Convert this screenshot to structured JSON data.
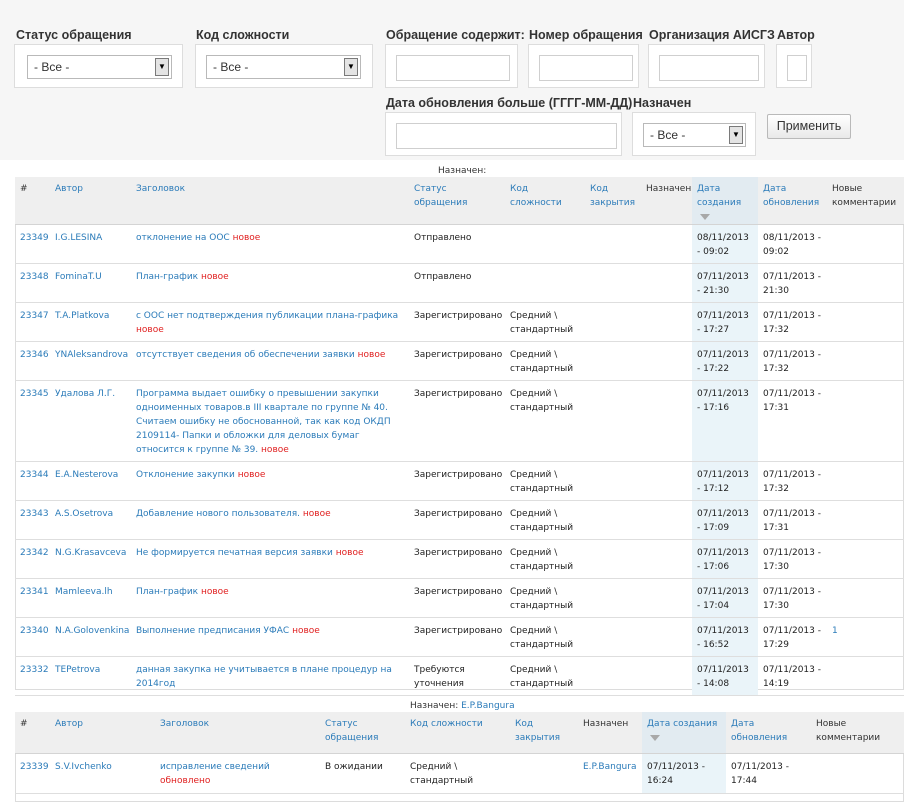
{
  "filters": {
    "status": {
      "label": "Статус обращения",
      "value": "- Все -"
    },
    "complexity": {
      "label": "Код сложности",
      "value": "- Все -"
    },
    "contains": {
      "label": "Обращение содержит:",
      "value": ""
    },
    "number": {
      "label": "Номер обращения",
      "value": ""
    },
    "org": {
      "label": "Организация АИСГЗ",
      "value": ""
    },
    "author": {
      "label": "Автор",
      "value": ""
    },
    "updated": {
      "label": "Дата обновления больше (ГГГГ-ММ-ДД)",
      "value": ""
    },
    "assigned": {
      "label": "Назначен",
      "value": "- Все -"
    },
    "apply_label": "Применить"
  },
  "new_badge": "новое",
  "updated_badge": "обновлено",
  "group1": {
    "caption": "Назначен:",
    "assignee": "",
    "headers": [
      "#",
      "Автор",
      "Заголовок",
      "Статус обращения",
      "Код сложности",
      "Код закрытия",
      "Назначен",
      "Дата создания",
      "Дата обновления",
      "Новые комментарии"
    ],
    "rows": [
      {
        "id": "23349",
        "author": "I.G.LESINA",
        "title": "отклонение на ООС",
        "badge": "новое",
        "status": "Отправлено",
        "complexity": "",
        "close": "",
        "assigned": "",
        "created": "08/11/2013 - 09:02",
        "updated": "08/11/2013 - 09:02",
        "comments": ""
      },
      {
        "id": "23348",
        "author": "FominaT.U",
        "title": "План-график",
        "badge": "новое",
        "status": "Отправлено",
        "complexity": "",
        "close": "",
        "assigned": "",
        "created": "07/11/2013 - 21:30",
        "updated": "07/11/2013 - 21:30",
        "comments": ""
      },
      {
        "id": "23347",
        "author": "T.A.Platkova",
        "title": "с ООС нет подтверждения публикации плана-графика",
        "badge": "новое",
        "status": "Зарегистрировано",
        "complexity": "Средний \\ стандартный",
        "close": "",
        "assigned": "",
        "created": "07/11/2013 - 17:27",
        "updated": "07/11/2013 - 17:32",
        "comments": ""
      },
      {
        "id": "23346",
        "author": "YNAleksandrova",
        "title": "отсутствует сведения об обеспечении заявки",
        "badge": "новое",
        "status": "Зарегистрировано",
        "complexity": "Средний \\ стандартный",
        "close": "",
        "assigned": "",
        "created": "07/11/2013 - 17:22",
        "updated": "07/11/2013 - 17:32",
        "comments": ""
      },
      {
        "id": "23345",
        "author": "Удалова Л.Г.",
        "title": "Программа выдает ошибку о превышении закупки одноименных товаров.в III квартале по группе № 40. Считаем ошибку не обоснованной, так как код ОКДП 2109114- Папки и обложки для деловых бумаг относится к группе № 39.",
        "badge": "новое",
        "status": "Зарегистрировано",
        "complexity": "Средний \\ стандартный",
        "close": "",
        "assigned": "",
        "created": "07/11/2013 - 17:16",
        "updated": "07/11/2013 - 17:31",
        "comments": ""
      },
      {
        "id": "23344",
        "author": "E.A.Nesterova",
        "title": "Отклонение закупки",
        "badge": "новое",
        "status": "Зарегистрировано",
        "complexity": "Средний \\ стандартный",
        "close": "",
        "assigned": "",
        "created": "07/11/2013 - 17:12",
        "updated": "07/11/2013 - 17:32",
        "comments": ""
      },
      {
        "id": "23343",
        "author": "A.S.Osetrova",
        "title": "Добавление нового пользователя.",
        "badge": "новое",
        "status": "Зарегистрировано",
        "complexity": "Средний \\ стандартный",
        "close": "",
        "assigned": "",
        "created": "07/11/2013 - 17:09",
        "updated": "07/11/2013 - 17:31",
        "comments": ""
      },
      {
        "id": "23342",
        "author": "N.G.Krasavceva",
        "title": "Не формируется печатная версия заявки",
        "badge": "новое",
        "status": "Зарегистрировано",
        "complexity": "Средний \\ стандартный",
        "close": "",
        "assigned": "",
        "created": "07/11/2013 - 17:06",
        "updated": "07/11/2013 - 17:30",
        "comments": ""
      },
      {
        "id": "23341",
        "author": "Mamleeva.lh",
        "title": "План-график",
        "badge": "новое",
        "status": "Зарегистрировано",
        "complexity": "Средний \\ стандартный",
        "close": "",
        "assigned": "",
        "created": "07/11/2013 - 17:04",
        "updated": "07/11/2013 - 17:30",
        "comments": ""
      },
      {
        "id": "23340",
        "author": "N.A.Golovenkina",
        "title": "Выполнение предписания УФАС",
        "badge": "новое",
        "status": "Зарегистрировано",
        "complexity": "Средний \\ стандартный",
        "close": "",
        "assigned": "",
        "created": "07/11/2013 - 16:52",
        "updated": "07/11/2013 - 17:29",
        "comments": "1"
      },
      {
        "id": "23332",
        "author": "TEPetrova",
        "title": "данная закупка не учитывается в плане процедур на 2014год",
        "badge": "",
        "status": "Требуются уточнения",
        "complexity": "Средний \\ стандартный",
        "close": "",
        "assigned": "",
        "created": "07/11/2013 - 14:08",
        "updated": "07/11/2013 - 14:19",
        "comments": ""
      }
    ]
  },
  "group2": {
    "caption": "Назначен:",
    "assignee": "E.P.Bangura",
    "headers": [
      "#",
      "Автор",
      "Заголовок",
      "Статус обращения",
      "Код сложности",
      "Код закрытия",
      "Назначен",
      "Дата создания",
      "Дата обновления",
      "Новые комментарии"
    ],
    "rows": [
      {
        "id": "23339",
        "author": "S.V.Ivchenko",
        "title": "исправление сведений",
        "badge": "обновлено",
        "status": "В ожидании",
        "complexity": "Средний \\ стандартный",
        "close": "",
        "assigned": "E.P.Bangura",
        "created": "07/11/2013 - 16:24",
        "updated": "07/11/2013 - 17:44",
        "comments": ""
      }
    ]
  }
}
